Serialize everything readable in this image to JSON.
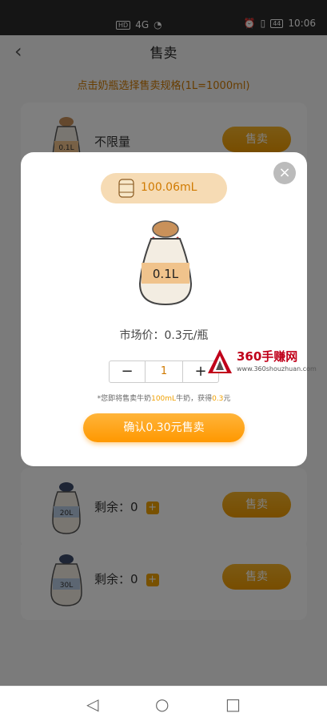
{
  "status_bar": {
    "left_badge": "HD",
    "signal_text": "4G",
    "battery": "44",
    "time": "10:06"
  },
  "header": {
    "title": "售卖"
  },
  "hint": "点击奶瓶选择售卖规格(1L=1000ml)",
  "cards": [
    {
      "bottle_label": "0.1L",
      "label": "不限量",
      "sell": "售卖"
    },
    {
      "bottle_label": "20L",
      "label": "剩余：0",
      "sell": "售卖"
    },
    {
      "bottle_label": "30L",
      "label": "剩余：0",
      "sell": "售卖"
    }
  ],
  "modal": {
    "balance": "100.06mL",
    "bottle_label": "0.1L",
    "price": "市场价：0.3元/瓶",
    "quantity": "1",
    "note_prefix": "*您即将售卖牛奶",
    "note_amount": "100mL",
    "note_middle": "牛奶，获得",
    "note_value": "0.3",
    "note_suffix": "元",
    "confirm": "确认0.30元售卖"
  },
  "watermark": {
    "title": "360手赚网",
    "url": "www.360shouzhuan.com"
  },
  "colors": {
    "accent": "#f0a300",
    "accent_text": "#d07a00"
  }
}
